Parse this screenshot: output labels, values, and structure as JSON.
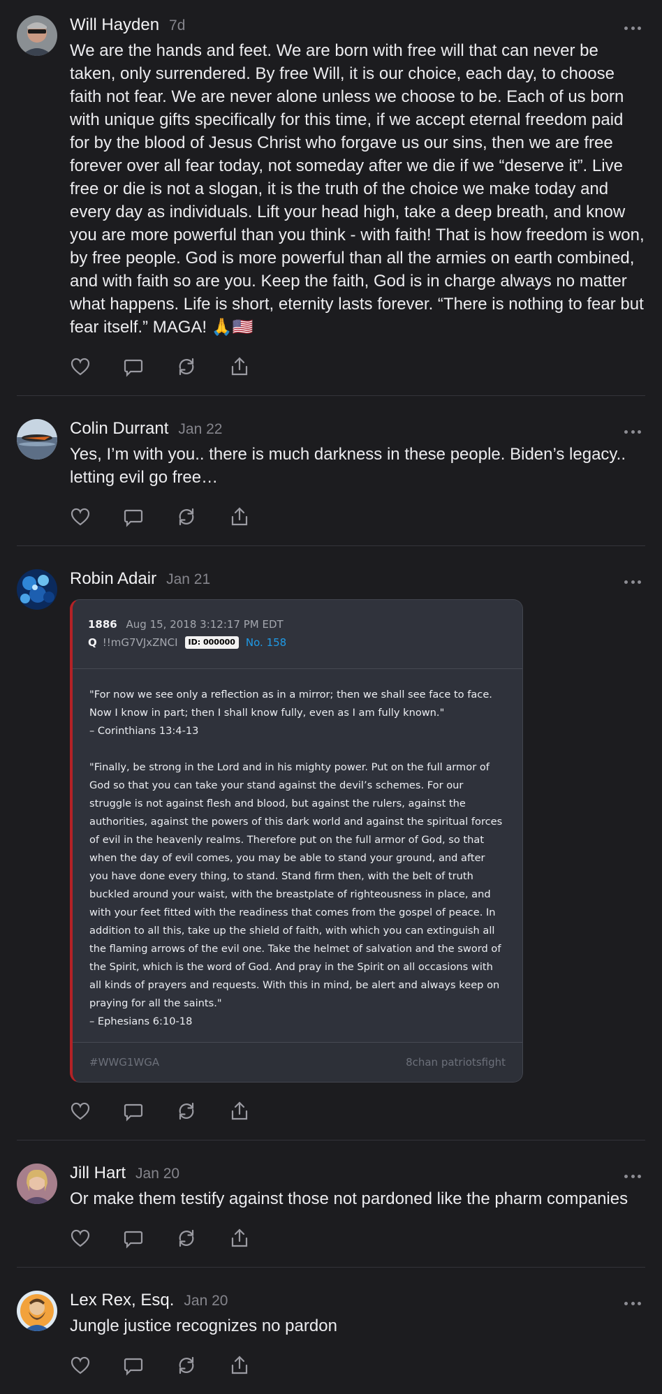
{
  "posts": [
    {
      "author": "Will Hayden",
      "date": "7d",
      "text": "We are the hands and feet. We are born with free will that can never be taken, only surrendered. By free Will, it is our choice, each day, to choose faith not fear. We are never alone unless we choose to be. Each of us born with unique gifts specifically for this time, if we accept eternal freedom paid for by the blood of Jesus Christ who forgave us our sins, then we are free forever over all fear today, not someday after we die if we “deserve it”. Live free or die is not a slogan, it is the truth of the choice we make today and every day as individuals. Lift your head high, take a deep breath, and know you are more powerful than you think - with faith! That is how freedom is won, by free people. God is more powerful than all the armies on earth combined, and with faith so are you. Keep the faith, God is in charge always no matter what happens. Life is short, eternity lasts forever. “There is nothing to fear but fear itself.” MAGA! 🙏🇺🇸"
    },
    {
      "author": "Colin Durrant",
      "date": "Jan 22",
      "text": "Yes, I’m with you.. there is much darkness in these people. Biden’s legacy.. letting evil go free…"
    },
    {
      "author": "Robin Adair",
      "date": "Jan 21",
      "text": "",
      "card": {
        "post_number": "1886",
        "timestamp": "Aug 15, 2018 3:12:17 PM EDT",
        "poster": "Q",
        "tripcode": "!!mG7VJxZNCI",
        "id_badge": "ID: 000000",
        "number": "No. 158",
        "body": "\"For now we see only a reflection as in a mirror; then we shall see face to face. Now I know in part; then I shall know fully, even as I am fully known.\"\n– Corinthians 13:4-13\n\n\"Finally, be strong in the Lord and in his mighty power. Put on the full armor of God so that you can take your stand against the devil’s schemes. For our struggle is not against flesh and blood, but against the rulers, against the authorities, against the powers of this dark world and against the spiritual forces of evil in the heavenly realms. Therefore put on the full armor of God, so that when the day of evil comes, you may be able to stand your ground, and after you have done every thing, to stand. Stand firm then, with the belt of truth buckled around your waist, with the breastplate of righteousness in place, and with your feet fitted with the readiness that comes from the gospel of peace. In addition to all this, take up the shield of faith, with which you can extinguish all the flaming arrows of the evil one. Take the helmet of salvation and the sword of the Spirit, which is the word of God. And pray in the Spirit on all occasions with all kinds of prayers and requests. With this in mind, be alert and always keep on praying for all the saints.\"\n– Ephesians 6:10-18",
        "hashtag": "#WWG1WGA",
        "source": "8chan patriotsfight"
      }
    },
    {
      "author": "Jill Hart",
      "date": "Jan 20",
      "text": "Or make them testify against those not pardoned like the pharm companies"
    },
    {
      "author": "Lex Rex, Esq.",
      "date": "Jan 20",
      "text": "Jungle justice recognizes no pardon"
    }
  ],
  "icons": {
    "like": "heart-icon",
    "reply": "comment-icon",
    "repost": "repost-icon",
    "share": "share-icon",
    "more": "more-options-icon"
  },
  "colors": {
    "background": "#1c1c1f",
    "accent_blue": "#1f9ae6",
    "card_border_red": "#b32226"
  }
}
